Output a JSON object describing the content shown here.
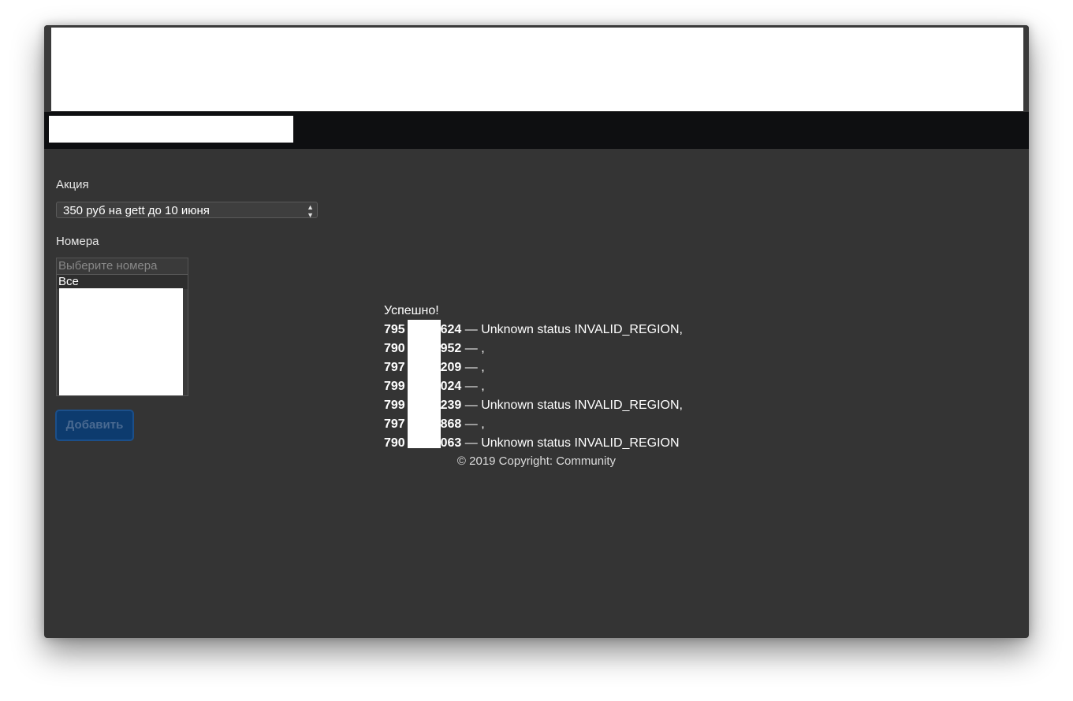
{
  "form": {
    "promo_label": "Акция",
    "promo_selected": "350 руб на gett до 10 июня",
    "numbers_label": "Номера",
    "numbers_placeholder": "Выберите номера",
    "numbers_option_all": "Все",
    "submit_label": "Добавить"
  },
  "results": {
    "success": "Успешно!",
    "rows": [
      {
        "number": "795",
        "number_end": "3624",
        "status": " — Unknown status INVALID_REGION,"
      },
      {
        "number": "790",
        "number_end": "1952",
        "status": " — ,"
      },
      {
        "number": "797",
        "number_end": "8209",
        "status": " — ,"
      },
      {
        "number": "799",
        "number_end": "9024",
        "status": " — ,"
      },
      {
        "number": "799",
        "number_end": "5239",
        "status": " — Unknown status INVALID_REGION,"
      },
      {
        "number": "797",
        "number_end": "9868",
        "status": " — ,"
      },
      {
        "number": "790",
        "number_end": "8063",
        "status": " — Unknown status INVALID_REGION"
      }
    ]
  },
  "footer": {
    "copyright": "© 2019 Copyright: Community"
  }
}
